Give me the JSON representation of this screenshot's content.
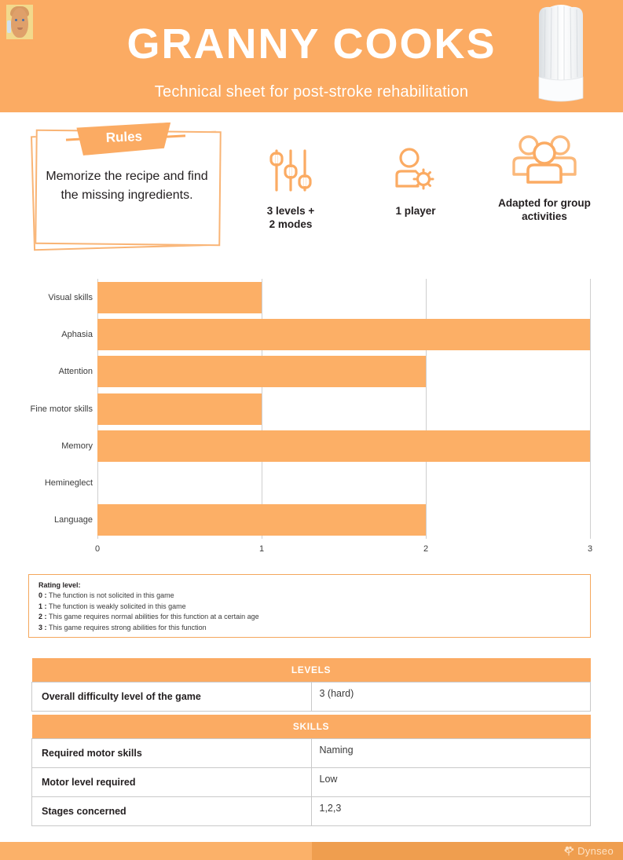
{
  "header": {
    "title": "GRANNY COOKS",
    "subtitle": "Technical sheet for post-stroke rehabilitation",
    "avatar_icon": "granny-avatar-icon",
    "hat_icon": "chef-hat-icon",
    "bg_color": "#fbab63"
  },
  "rules": {
    "banner_label": "Rules",
    "text": "Memorize the recipe and find the missing ingredients."
  },
  "features": [
    {
      "icon": "sliders-icon",
      "label": "3 levels +\n2 modes"
    },
    {
      "icon": "player-settings-icon",
      "label": "1 player"
    },
    {
      "icon": "group-people-icon",
      "label": "Adapted for group\nactivities"
    }
  ],
  "chart_data": {
    "type": "bar",
    "orientation": "horizontal",
    "title": "",
    "xlabel": "",
    "ylabel": "",
    "categories": [
      "Visual skills",
      "Aphasia",
      "Attention",
      "Fine motor skills",
      "Memory",
      "Hemineglect",
      "Language"
    ],
    "values": [
      1,
      3,
      2,
      1,
      3,
      0,
      2
    ],
    "xticks": [
      0,
      1,
      2,
      3
    ],
    "xlim": [
      0,
      3
    ],
    "grid": true,
    "legend": "none",
    "bar_color": "#fcaf66"
  },
  "rating": {
    "title": "Rating level:",
    "lines": [
      {
        "num": "0 : ",
        "text": "The function is not solicited in this game"
      },
      {
        "num": "1 : ",
        "text": "The function is weakly solicited in this game"
      },
      {
        "num": "2 : ",
        "text": "This game requires normal abilities for this function at a certain age"
      },
      {
        "num": "3 : ",
        "text": "This game requires strong abilities for this function"
      }
    ]
  },
  "levels_table": {
    "header": "LEVELS",
    "rows": [
      {
        "key": "Overall difficulty level of the game",
        "value": "3 (hard)"
      }
    ]
  },
  "skills_table": {
    "header": "SKILLS",
    "rows": [
      {
        "key": "Required motor skills",
        "value": "Naming"
      },
      {
        "key": "Motor level required",
        "value": "Low"
      },
      {
        "key": "Stages concerned",
        "value": "1,2,3"
      }
    ]
  },
  "footer": {
    "brand": "Dynseo",
    "brand_icon": "dynseo-brain-icon"
  }
}
